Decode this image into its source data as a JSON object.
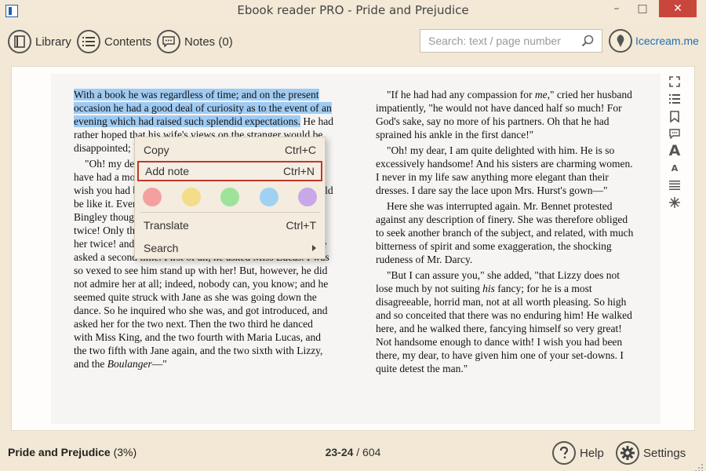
{
  "window": {
    "title": "Ebook reader PRO - Pride and Prejudice",
    "minimize": "–",
    "maximize": "□",
    "close": "✕"
  },
  "toolbar": {
    "library_label": "Library",
    "contents_label": "Contents",
    "notes_label": "Notes (0)",
    "search_placeholder": "Search: text / page number",
    "brand": "Icecream.me"
  },
  "page": {
    "left": {
      "p1_highlighted": "With a book he was regardless of time; and on the present occasion he had a good deal of curiosity as to the event of an evening which had raised such splendid expectations.",
      "p1_rest": " He had rather hoped that his wife's views on the stranger would be disappointed; but he soon found out that",
      "p2": "\"Oh! my dear Mr. Bennet,\" as she entered the room, \"we have had a most delightful evening, a most excellent ball. I wish you had been there. Jane was so admired, nothing could be like it. Everybody said how well she looked; and Mr. Bingley thought her quite beautiful, and danced with her twice! Only think of that, my dear; he actually danced with her twice! and she was the only creature in the room that he asked a second time. First of all, he asked Miss Lucas. I was so vexed to see him stand up with her! But, however, he did not admire her at all; indeed, nobody can, you know; and he seemed quite struck with Jane as she was going down the dance. So he inquired who she was, and got introduced, and asked her for the two next. Then the two third he danced with Miss King, and the two fourth with Maria Lucas, and the two fifth with Jane again, and the two sixth with Lizzy, and the ",
      "p2_italic": "Boulanger",
      "p2_end": "—\""
    },
    "right": {
      "p1_a": "\"If he had had any compassion for ",
      "p1_italic": "me",
      "p1_b": ",\" cried her husband impatiently, \"he would not have danced half so much! For God's sake, say no more of his partners. Oh that he had sprained his ankle in the first dance!\"",
      "p2": "\"Oh! my dear, I am quite delighted with him. He is so excessively handsome! And his sisters are charming women. I never in my life saw anything more elegant than their dresses. I dare say the lace upon Mrs. Hurst's gown—\"",
      "p3": "Here she was interrupted again. Mr. Bennet protested against any description of finery. She was therefore obliged to seek another branch of the subject, and related, with much bitterness of spirit and some exaggeration, the shocking rudeness of Mr. Darcy.",
      "p4_a": "\"But I can assure you,\" she added, \"that Lizzy does not lose much by not suiting ",
      "p4_italic": "his",
      "p4_b": " fancy; for he is a most disagreeable, horrid man, not at all worth pleasing. So high and so conceited that there was no enduring him! He walked here, and he walked there, fancying himself so very great! Not handsome enough to dance with! I wish you had been there, my dear, to have given him one of your set-downs. I quite detest the man.\""
    }
  },
  "context_menu": {
    "copy": "Copy",
    "copy_shortcut": "Ctrl+C",
    "add_note": "Add note",
    "add_note_shortcut": "Ctrl+N",
    "translate": "Translate",
    "translate_shortcut": "Ctrl+T",
    "search": "Search",
    "highlight_colors": [
      "#f4a0a0",
      "#f4dc8a",
      "#9ee39a",
      "#9fd2f2",
      "#c8a8e6"
    ]
  },
  "side_tools": {
    "font_large": "A",
    "font_small": "A"
  },
  "status": {
    "book_title": "Pride and Prejudice",
    "progress": "(3%)",
    "current_pages": "23-24",
    "total_pages": "/ 604",
    "help": "Help",
    "settings": "Settings"
  },
  "colors": {
    "background": "#f2e8d5",
    "page": "#f6f5f4",
    "selection": "#9fcbf3",
    "close_button": "#c9463d",
    "brand_link": "#1f6fb5",
    "menu_highlight_border": "#c0392b"
  }
}
